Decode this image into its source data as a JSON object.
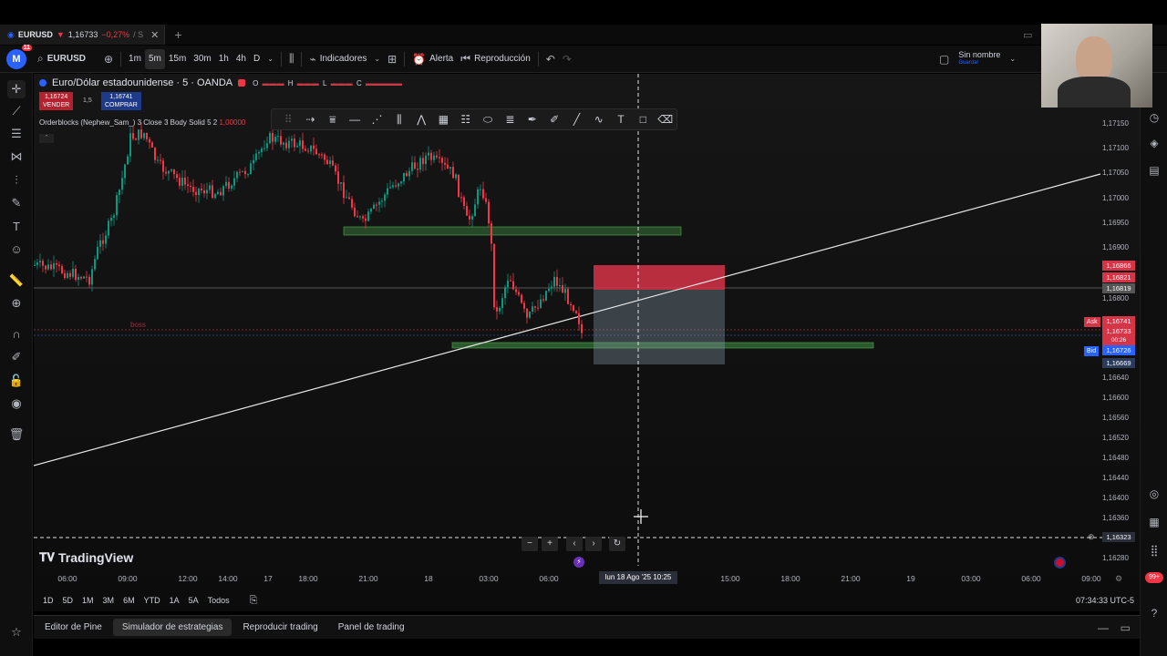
{
  "tab": {
    "symbol": "EURUSD",
    "price": "1,16733",
    "change": "−0,27%",
    "trailing": "/ S"
  },
  "topbar": {
    "avatar_letter": "M",
    "avatar_badge": "11",
    "symbol": "EURUSD",
    "intervals": [
      "1m",
      "5m",
      "15m",
      "30m",
      "1h",
      "4h",
      "D"
    ],
    "active_interval": "5m",
    "indicators_label": "Indicadores",
    "alert_label": "Alerta",
    "replay_label": "Reproducción",
    "layout_name": "Sin nombre",
    "save_label": "Guardar"
  },
  "legend": {
    "title": "Euro/Dólar estadounidense · 5 · OANDA",
    "o_label": "O",
    "h_label": "H",
    "l_label": "L",
    "c_label": "C",
    "sell_price": "1,16724",
    "sell_label": "VENDER",
    "spread": "1,5",
    "buy_price": "1,16741",
    "buy_label": "COMPRAR",
    "indicator": "Orderblocks (Nephew_Sam_) 3 Close 3 Body Solid 5 2",
    "indicator_value": "1,00000"
  },
  "annotation_boss": "boss",
  "price_axis": {
    "ticks": [
      "1,17150",
      "1,17100",
      "1,17050",
      "1,17000",
      "1,16950",
      "1,16900",
      "1,16800",
      "1,16640",
      "1,16600",
      "1,16560",
      "1,16520",
      "1,16480",
      "1,16440",
      "1,16400",
      "1,16360",
      "1,16280"
    ],
    "labels": {
      "red_1": "1,16866",
      "red_2": "1,16821",
      "grey_1": "1,16819",
      "ask_tag": "Ask",
      "ask_price": "1,16741",
      "current_price": "1,16733",
      "countdown": "00:26",
      "bid_tag": "Bid",
      "bid_price": "1,16726",
      "blue_2": "1,16669",
      "cursor_price": "1,16323"
    }
  },
  "time_axis": {
    "ticks": [
      "06:00",
      "09:00",
      "12:00",
      "14:00",
      "17",
      "18:00",
      "21:00",
      "18",
      "03:00",
      "06:00",
      "15:00",
      "18:00",
      "21:00",
      "19",
      "03:00",
      "06:00",
      "09:00"
    ],
    "cursor_label": "lun 18 Ago '25  10:25"
  },
  "watermark": "TradingView",
  "ranges": [
    "1D",
    "5D",
    "1M",
    "3M",
    "6M",
    "YTD",
    "1A",
    "5A",
    "Todos"
  ],
  "clock": "07:34:33 UTC-5",
  "bottom_tabs": [
    "Editor de Pine",
    "Simulador de estrategias",
    "Reproducir trading",
    "Panel de trading"
  ],
  "active_bottom_tab": "Simulador de estrategias",
  "right_badge": "99+",
  "colors": {
    "bull": "#089981",
    "bear": "#f23645",
    "accent": "#2962ff",
    "zone": "#4caf50"
  }
}
